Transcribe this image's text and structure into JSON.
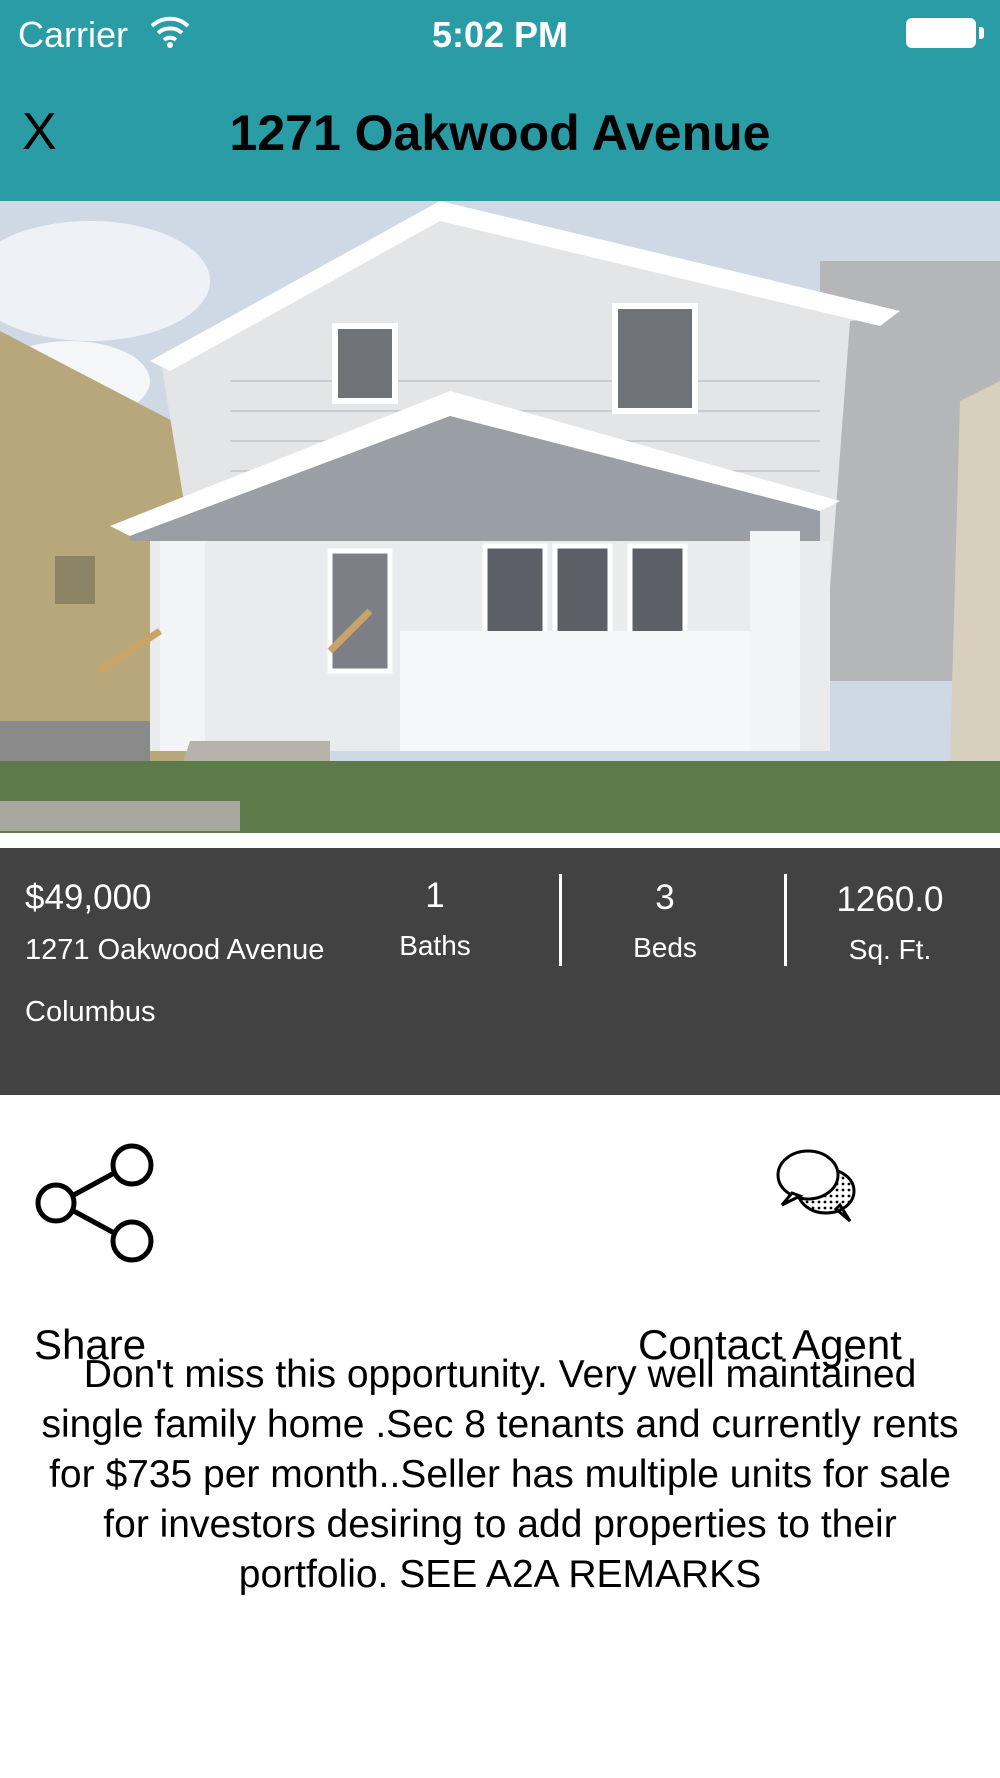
{
  "status_bar": {
    "carrier": "Carrier",
    "time": "5:02 PM"
  },
  "nav": {
    "close_label": "X",
    "title": "1271 Oakwood Avenue"
  },
  "listing": {
    "price": "$49,000",
    "address": "1271 Oakwood Avenue",
    "city": "Columbus",
    "baths": {
      "value": "1",
      "label": "Baths"
    },
    "beds": {
      "value": "3",
      "label": "Beds"
    },
    "sqft": {
      "value": "1260.0",
      "label": "Sq. Ft."
    }
  },
  "actions": {
    "share_label": "Share",
    "contact_label": "Contact Agent"
  },
  "description": "Don't miss this opportunity. Very well maintained single family home .Sec 8 tenants and currently rents for $735 per month..Seller has multiple units for sale for investors desiring to add properties to their portfolio. SEE A2A REMARKS",
  "colors": {
    "header_bg": "#2a9ca6",
    "info_panel_bg": "#424242"
  },
  "icons": [
    "wifi-icon",
    "battery-icon",
    "share-icon",
    "chat-bubbles-icon"
  ]
}
